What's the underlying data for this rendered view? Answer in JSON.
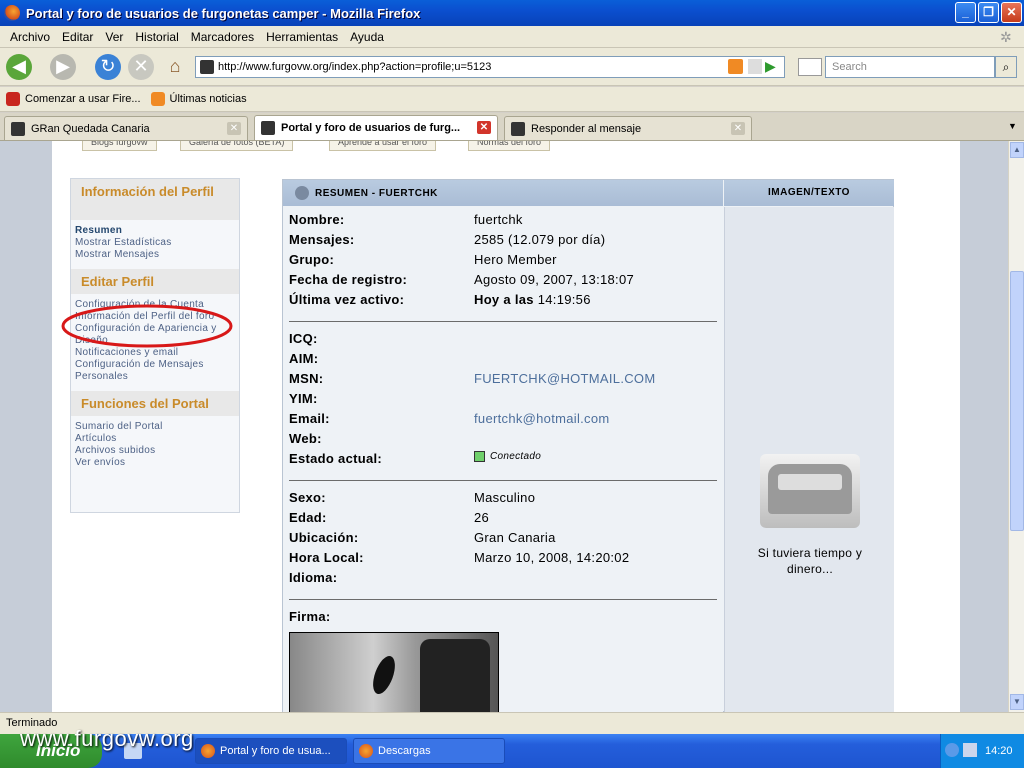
{
  "window": {
    "title": "Portal y foro de usuarios de furgonetas camper - Mozilla Firefox"
  },
  "menu": [
    "Archivo",
    "Editar",
    "Ver",
    "Historial",
    "Marcadores",
    "Herramientas",
    "Ayuda"
  ],
  "nav": {
    "url": "http://www.furgovw.org/index.php?action=profile;u=5123",
    "search_placeholder": "Search"
  },
  "bookmarks": [
    "Comenzar a usar Fire...",
    "Últimas noticias"
  ],
  "tabs": [
    {
      "label": "GRan Quedada Canaria",
      "active": false
    },
    {
      "label": "Portal y foro de usuarios de furg...",
      "active": true
    },
    {
      "label": "Responder al mensaje",
      "active": false
    }
  ],
  "top_nav": [
    "Blogs furgovw",
    "Galería de fotos (BETA)",
    "Aprende a usar el foro",
    "Normas del foro"
  ],
  "left_menu": {
    "sections": [
      {
        "title": "Información del Perfil",
        "items": [
          "Resumen",
          "Mostrar Estadísticas",
          "Mostrar Mensajes"
        ]
      },
      {
        "title": "Editar Perfil",
        "items": [
          "Configuración de la Cuenta",
          "Información del Perfil del foro",
          "Configuración de Apariencia y Diseño",
          "Notificaciones y email",
          "Configuración de Mensajes Personales"
        ]
      },
      {
        "title": "Funciones del Portal",
        "items": [
          "Sumario del Portal",
          "Artículos",
          "Archivos subidos",
          "Ver envíos"
        ]
      }
    ]
  },
  "profile": {
    "header": "RESUMEN - FUERTCHK",
    "image_header": "IMAGEN/TEXTO",
    "rows1": [
      {
        "label": "Nombre:",
        "value": "fuertchk"
      },
      {
        "label": "Mensajes:",
        "value": "2585 (12.079 por día)"
      },
      {
        "label": "Grupo:",
        "value": "Hero Member"
      },
      {
        "label": "Fecha de registro:",
        "value": "Agosto 09, 2007, 13:18:07"
      },
      {
        "label": "Última vez activo:",
        "value_bold": "Hoy a las",
        "value": "14:19:56"
      }
    ],
    "rows2": [
      {
        "label": "ICQ:",
        "value": ""
      },
      {
        "label": "AIM:",
        "value": ""
      },
      {
        "label": "MSN:",
        "value": "FUERTCHK@HOTMAIL.COM"
      },
      {
        "label": "YIM:",
        "value": ""
      },
      {
        "label": "Email:",
        "value": "fuertchk@hotmail.com"
      },
      {
        "label": "Web:",
        "value": ""
      },
      {
        "label": "Estado actual:",
        "value": "Conectado"
      }
    ],
    "rows3": [
      {
        "label": "Sexo:",
        "value": "Masculino"
      },
      {
        "label": "Edad:",
        "value": "26"
      },
      {
        "label": "Ubicación:",
        "value": "Gran Canaria"
      },
      {
        "label": "Hora Local:",
        "value": "Marzo 10, 2008, 14:20:02"
      },
      {
        "label": "Idioma:",
        "value": ""
      }
    ],
    "firma_label": "Firma:",
    "avatar_text": "Si tuviera tiempo y dinero..."
  },
  "status": "Terminado",
  "taskbar": {
    "start": "Inicio",
    "tasks": [
      "Portal y foro de usua...",
      "Descargas"
    ],
    "clock": "14:20"
  },
  "watermark": "www.furgovw.org"
}
